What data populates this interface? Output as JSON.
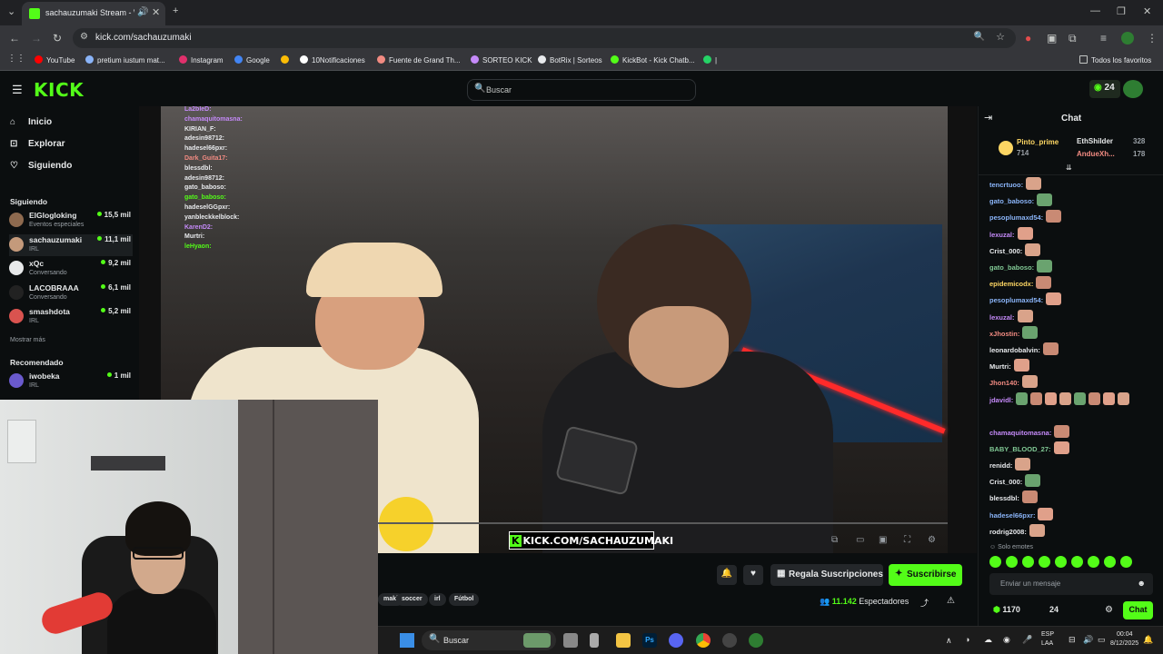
{
  "browser": {
    "tab_title": "sachauzumaki Stream - Watch",
    "url": "kick.com/sachauzumaki",
    "bookmarks": [
      {
        "label": "YouTube",
        "color": "#ff0000"
      },
      {
        "label": "pretium iustum mat...",
        "color": "#8ab4f8"
      },
      {
        "label": "Instagram",
        "color": "#e1306c"
      },
      {
        "label": "Google",
        "color": "#4285f4"
      },
      {
        "label": "",
        "color": "#fbbc05"
      },
      {
        "label": "10Notificaciones",
        "color": "#ffffff"
      },
      {
        "label": "Fuente de Grand Th...",
        "color": "#f28b82"
      },
      {
        "label": "SORTEO KICK",
        "color": "#c58af9"
      },
      {
        "label": "BotRix | Sorteos",
        "color": "#e8eaed"
      },
      {
        "label": "KickBot - Kick Chatb...",
        "color": "#53fc18"
      },
      {
        "label": "|",
        "color": "#25d366"
      }
    ],
    "all_favorites": "Todos los favoritos"
  },
  "kick": {
    "logo": "KICK",
    "search_placeholder": "Buscar",
    "points": "24",
    "nav": [
      {
        "label": "Inicio",
        "icon": "home-icon"
      },
      {
        "label": "Explorar",
        "icon": "compass-icon"
      },
      {
        "label": "Siguiendo",
        "icon": "heart-icon"
      }
    ],
    "following_header": "Siguiendo",
    "following": [
      {
        "name": "ElGlogloking",
        "category": "Eventos especiales",
        "viewers": "15,5 mil",
        "color": "#8e6a4f"
      },
      {
        "name": "sachauzumaki",
        "category": "IRL",
        "viewers": "11,1 mil",
        "color": "#c49a7b"
      },
      {
        "name": "xQc",
        "category": "Conversando",
        "viewers": "9,2 mil",
        "color": "#e7e9ea"
      },
      {
        "name": "LACOBRAAA",
        "category": "Conversando",
        "viewers": "6,1 mil",
        "color": "#222"
      },
      {
        "name": "smashdota",
        "category": "IRL",
        "viewers": "5,2 mil",
        "color": "#d9534f"
      }
    ],
    "show_more": "Mostrar más",
    "recommended_header": "Recomendado",
    "recommended": [
      {
        "name": "iwobeka",
        "category": "IRL",
        "viewers": "1 mil",
        "color": "#6a5acd"
      }
    ]
  },
  "video": {
    "watermark": "KICK.COM/SACHAUZUMAKI",
    "overlay_chat": [
      {
        "user": "La2bleD:",
        "color": "#c58af9"
      },
      {
        "user": "chamaquitomasna:",
        "color": "#c58af9"
      },
      {
        "user": "KIRIAN_F:",
        "color": "#e8eaed"
      },
      {
        "user": "adesin98712:",
        "color": "#e8eaed"
      },
      {
        "user": "hadesel66pxr:",
        "color": "#e8eaed"
      },
      {
        "user": "Dark_Guita17:",
        "color": "#f28b82"
      },
      {
        "user": "blessdbl:",
        "color": "#e8eaed"
      },
      {
        "user": "adesin98712:",
        "color": "#e8eaed"
      },
      {
        "user": "gato_baboso:",
        "color": "#e8eaed"
      },
      {
        "user": "gato_baboso:",
        "color": "#53fc18"
      },
      {
        "user": "hadeselGGpxr:",
        "color": "#e8eaed"
      },
      {
        "user": "yanbleckkelblock:",
        "color": "#e8eaed"
      },
      {
        "user": "KarenD2:",
        "color": "#c58af9"
      },
      {
        "user": "Murtri:",
        "color": "#e8eaed"
      },
      {
        "user": "leHyaon:",
        "color": "#53fc18"
      }
    ]
  },
  "stream_info": {
    "gift_label": "Regala Suscripciones",
    "subscribe_label": "Suscribirse",
    "tags": [
      "maki",
      "soccer",
      "irl",
      "Fútbol"
    ],
    "viewers": "11.142",
    "viewers_label": "Espectadores"
  },
  "chat": {
    "title": "Chat",
    "leaderboard": [
      {
        "name": "Pinto_prime",
        "value": "714"
      },
      {
        "name": "EthShilder",
        "value": "328"
      },
      {
        "name": "AndueXh...",
        "value": "178"
      }
    ],
    "messages": [
      {
        "user": "tencrtuoo:",
        "color": "#8ab4f8",
        "emotes": 1
      },
      {
        "user": "gato_baboso:",
        "color": "#8ab4f8",
        "emotes": 1
      },
      {
        "user": "pesoplumaxd54:",
        "color": "#8ab4f8",
        "emotes": 1
      },
      {
        "user": "lexuzal:",
        "color": "#c58af9",
        "emotes": 1
      },
      {
        "user": "Crist_000:",
        "color": "#e8eaed",
        "emotes": 1
      },
      {
        "user": "gato_baboso:",
        "color": "#81c995",
        "emotes": 1
      },
      {
        "user": "epidemicodx:",
        "color": "#fdd663",
        "emotes": 1
      },
      {
        "user": "pesoplumaxd54:",
        "color": "#8ab4f8",
        "emotes": 1
      },
      {
        "user": "lexuzal:",
        "color": "#c58af9",
        "emotes": 1
      },
      {
        "user": "xJhostin:",
        "color": "#f28b82",
        "emotes": 1
      },
      {
        "user": "leonardobalvin:",
        "color": "#e8eaed",
        "emotes": 1
      },
      {
        "user": "Murtri:",
        "color": "#e8eaed",
        "emotes": 1
      },
      {
        "user": "Jhon140:",
        "color": "#f28b82",
        "emotes": 1
      },
      {
        "user": "jdavidl:",
        "color": "#c58af9",
        "emotes": 8
      },
      {
        "user": "chamaquitomasna:",
        "color": "#c58af9",
        "emotes": 1
      },
      {
        "user": "BABY_BLOOD_27:",
        "color": "#81c995",
        "emotes": 1
      },
      {
        "user": "renidd:",
        "color": "#e8eaed",
        "emotes": 1
      },
      {
        "user": "Crist_000:",
        "color": "#e8eaed",
        "emotes": 1
      },
      {
        "user": "blessdbl:",
        "color": "#e8eaed",
        "emotes": 1
      },
      {
        "user": "hadesel66pxr:",
        "color": "#8ab4f8",
        "emotes": 1
      },
      {
        "user": "rodrig2008:",
        "color": "#e8eaed",
        "emotes": 1
      }
    ],
    "emotes_only": "Solo emotes",
    "input_placeholder": "Enviar un mensaje",
    "points": "1170",
    "count": "24",
    "chat_button": "Chat"
  },
  "taskbar": {
    "search": "Buscar",
    "lang": "ESP",
    "region": "LAA",
    "time": "00:04",
    "date": "8/12/2025"
  }
}
